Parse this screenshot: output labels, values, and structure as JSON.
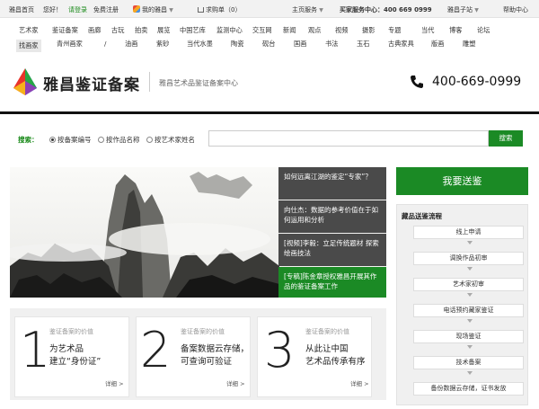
{
  "topbar": {
    "home": "雅昌首页",
    "greeting": "您好！",
    "login": "请登录",
    "register": "免费注册",
    "my_artron": "我的雅昌",
    "cart": "求购单（0）",
    "service": "主页服务",
    "hotline": "买家服务中心：400 669 0999",
    "substation": "雅昌子站",
    "help": "帮助中心"
  },
  "nav": {
    "row1": [
      "艺术家",
      "鉴证备案",
      "画廊",
      "古玩",
      "拍卖",
      "展览",
      "中国艺库",
      "监测中心",
      "交互网",
      "新闻",
      "观点",
      "视频",
      "摄影",
      "专题",
      "当代",
      "博客",
      "论坛"
    ],
    "row2": [
      "找画家",
      "青州画家",
      "/",
      "油画",
      "紫砂",
      "当代水墨",
      "陶瓷",
      "砚台",
      "国画",
      "书法",
      "玉石",
      "古典家具",
      "版画",
      "雕塑"
    ]
  },
  "header": {
    "logo_text": "雅昌鉴证备案",
    "subtitle": "雅昌艺术品鉴证备案中心",
    "phone": "400-669-0999"
  },
  "search": {
    "label": "搜索：",
    "options": [
      "按备案编号",
      "按作品名称",
      "按艺术家姓名"
    ],
    "button": "搜索"
  },
  "news": [
    "如何远离江湖的鉴定“专家”？",
    "向仕杰：数据的参考价值在于如何运用和分析",
    "[视频]李毅：立足传统题材 探索绘画技法",
    "[专稿]陈金章授权雅昌开展其作品的鉴证备案工作"
  ],
  "send_button": "我要送鉴",
  "flow": {
    "title": "藏品送鉴流程",
    "steps": [
      "线上申请",
      "调换作品初审",
      "艺术家初审",
      "电话预约藏家鉴证",
      "现场鉴证",
      "技术备案",
      "备份数据云存储，证书发放"
    ]
  },
  "cards": [
    {
      "num": "1",
      "head": "鉴证备案的价值",
      "line1": "为艺术品",
      "line2": "建立“身份证”",
      "more": "详细 >"
    },
    {
      "num": "2",
      "head": "鉴证备案的价值",
      "line1": "备案数据云存储，",
      "line2": "可查询可验证",
      "more": "详细 >"
    },
    {
      "num": "3",
      "head": "鉴证备案的价值",
      "line1": "从此让中国",
      "line2": "艺术品传承有序",
      "more": "详细 >"
    }
  ],
  "colors": {
    "green": "#1b8a25",
    "dark": "#4a4a4a"
  }
}
